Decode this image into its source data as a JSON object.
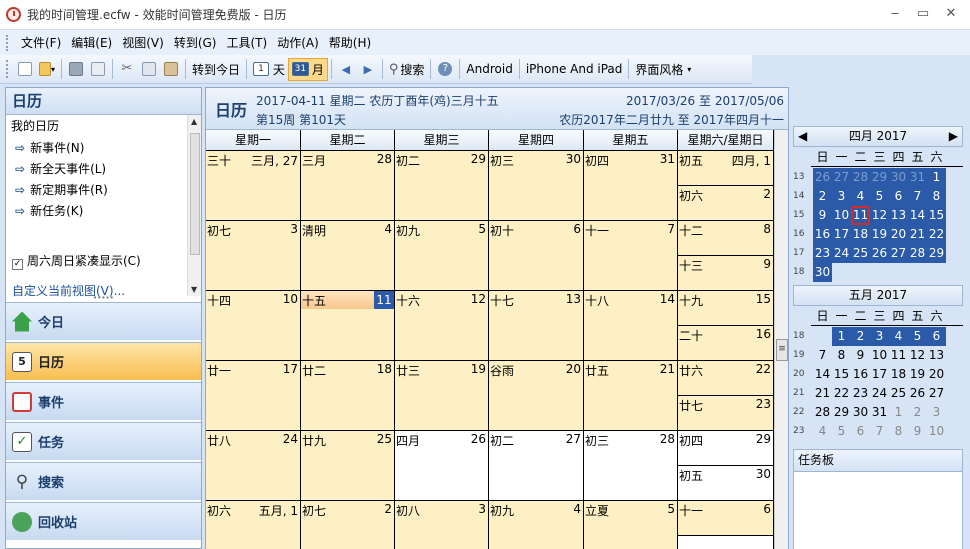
{
  "window": {
    "title": "我的时间管理.ecfw - 效能时间管理免费版 - 日历"
  },
  "menu": [
    "文件(F)",
    "编辑(E)",
    "视图(V)",
    "转到(G)",
    "工具(T)",
    "动作(A)",
    "帮助(H)"
  ],
  "toolbar": {
    "goto_today": "转到今日",
    "day": "天",
    "month": "月",
    "search": "搜索",
    "android": "Android",
    "iphone": "iPhone And iPad",
    "theme": "界面风格"
  },
  "sidebar": {
    "header": "日历",
    "my_calendar": "我的日历",
    "items": [
      "新事件(N)",
      "新全天事件(L)",
      "新定期事件(R)",
      "新任务(K)"
    ],
    "weekend_compact": "周六周日紧凑显示(C)",
    "custom_view": "自定义当前视图(V)...",
    "nav": [
      "今日",
      "日历",
      "事件",
      "任务",
      "搜索",
      "回收站"
    ]
  },
  "main": {
    "title": "日历",
    "date_line": "2017-04-11 星期二 农历丁酉年(鸡)三月十五",
    "week_line": "第15周 第101天",
    "range": "2017/03/26 至 2017/05/06",
    "lunar_range": "农历2017年二月廿九 至 2017年四月十一",
    "col_headers": [
      "星期一",
      "星期二",
      "星期三",
      "星期四",
      "星期五",
      "星期六/星期日"
    ],
    "weeks": [
      {
        "days": [
          [
            "三十",
            "三月, 27"
          ],
          [
            "三月",
            "28"
          ],
          [
            "初二",
            "29"
          ],
          [
            "初三",
            "30"
          ],
          [
            "初四",
            "31"
          ]
        ],
        "sat": [
          "初五",
          "四月, 1"
        ],
        "sun": [
          "初六",
          "2"
        ]
      },
      {
        "days": [
          [
            "初七",
            "3"
          ],
          [
            "清明",
            "4"
          ],
          [
            "初九",
            "5"
          ],
          [
            "初十",
            "6"
          ],
          [
            "十一",
            "7"
          ]
        ],
        "sat": [
          "十二",
          "8"
        ],
        "sun": [
          "十三",
          "9"
        ]
      },
      {
        "days": [
          [
            "十四",
            "10"
          ],
          [
            "十五",
            "11"
          ],
          [
            "十六",
            "12"
          ],
          [
            "十七",
            "13"
          ],
          [
            "十八",
            "14"
          ]
        ],
        "sat": [
          "十九",
          "15"
        ],
        "sun": [
          "二十",
          "16"
        ]
      },
      {
        "days": [
          [
            "廿一",
            "17"
          ],
          [
            "廿二",
            "18"
          ],
          [
            "廿三",
            "19"
          ],
          [
            "谷雨",
            "20"
          ],
          [
            "廿五",
            "21"
          ]
        ],
        "sat": [
          "廿六",
          "22"
        ],
        "sun": [
          "廿七",
          "23"
        ]
      },
      {
        "days": [
          [
            "廿八",
            "24"
          ],
          [
            "廿九",
            "25"
          ],
          [
            "四月",
            "26"
          ],
          [
            "初二",
            "27"
          ],
          [
            "初三",
            "28"
          ]
        ],
        "sat": [
          "初四",
          "29"
        ],
        "sun": [
          "初五",
          "30"
        ]
      },
      {
        "days": [
          [
            "初六",
            "五月, 1"
          ],
          [
            "初七",
            "2"
          ],
          [
            "初八",
            "3"
          ],
          [
            "初九",
            "4"
          ],
          [
            "立夏",
            "5"
          ]
        ],
        "sat": [
          "十一",
          "6"
        ],
        "sun": [
          "",
          ""
        ]
      }
    ]
  },
  "mini_calendars": [
    {
      "title": "四月 2017",
      "dow": [
        "日",
        "一",
        "二",
        "三",
        "四",
        "五",
        "六"
      ],
      "weeks": [
        {
          "wk": "13",
          "days": [
            "26",
            "27",
            "28",
            "29",
            "30",
            "31",
            "1"
          ]
        },
        {
          "wk": "14",
          "days": [
            "2",
            "3",
            "4",
            "5",
            "6",
            "7",
            "8"
          ]
        },
        {
          "wk": "15",
          "days": [
            "9",
            "10",
            "11",
            "12",
            "13",
            "14",
            "15"
          ]
        },
        {
          "wk": "16",
          "days": [
            "16",
            "17",
            "18",
            "19",
            "20",
            "21",
            "22"
          ]
        },
        {
          "wk": "17",
          "days": [
            "23",
            "24",
            "25",
            "26",
            "27",
            "28",
            "29"
          ]
        },
        {
          "wk": "18",
          "days": [
            "30"
          ]
        }
      ]
    },
    {
      "title": "五月 2017",
      "dow": [
        "日",
        "一",
        "二",
        "三",
        "四",
        "五",
        "六"
      ],
      "weeks": [
        {
          "wk": "18",
          "days": [
            "",
            "1",
            "2",
            "3",
            "4",
            "5",
            "6"
          ]
        },
        {
          "wk": "19",
          "days": [
            "7",
            "8",
            "9",
            "10",
            "11",
            "12",
            "13"
          ]
        },
        {
          "wk": "20",
          "days": [
            "14",
            "15",
            "16",
            "17",
            "18",
            "19",
            "20"
          ]
        },
        {
          "wk": "21",
          "days": [
            "21",
            "22",
            "23",
            "24",
            "25",
            "26",
            "27"
          ]
        },
        {
          "wk": "22",
          "days": [
            "28",
            "29",
            "30",
            "31",
            "1",
            "2",
            "3"
          ]
        },
        {
          "wk": "23",
          "days": [
            "4",
            "5",
            "6",
            "7",
            "8",
            "9",
            "10"
          ]
        }
      ]
    }
  ],
  "taskpad": "任务板"
}
